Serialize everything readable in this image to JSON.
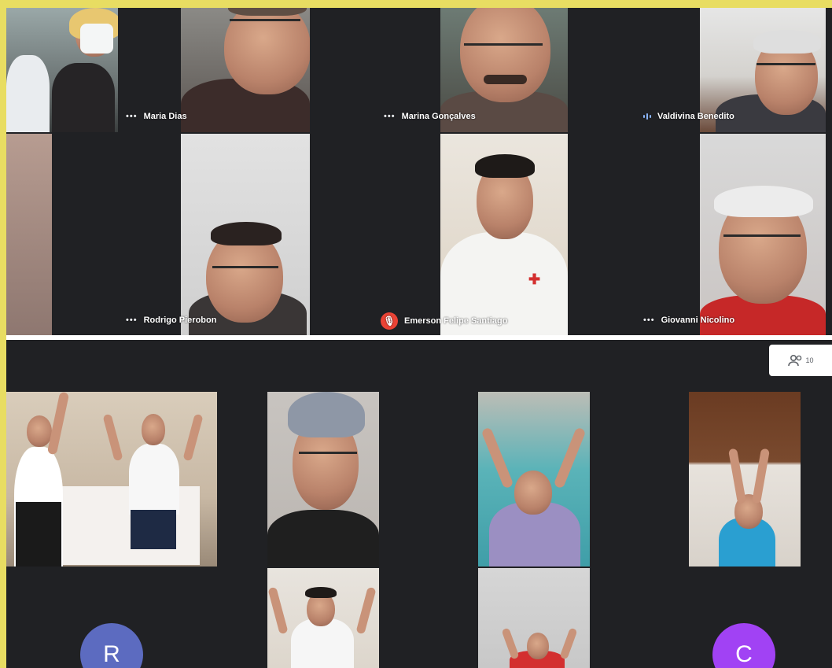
{
  "top_grid": {
    "participants": [
      {
        "name": "Maria Dias",
        "status_icon": "more-options-icon"
      },
      {
        "name": "Marina Gonçalves",
        "status_icon": "more-options-icon"
      },
      {
        "name": "Valdivina Benedito",
        "status_icon": "speaking-indicator-icon"
      },
      {
        "name": "Rodrigo Pierobon",
        "status_icon": "more-options-icon"
      },
      {
        "name": "Emerson Felipe Santiago",
        "status_icon": "mic-off-icon"
      },
      {
        "name": "Giovanni Nicolino",
        "status_icon": "more-options-icon"
      }
    ]
  },
  "bottom_grid": {
    "participant_count": "10",
    "avatars": [
      {
        "letter": "R",
        "color": "#5c6bc0"
      },
      {
        "letter": "C",
        "color": "#a142f4"
      }
    ]
  },
  "colors": {
    "background": "#e8dd62",
    "meeting_bg": "#202124",
    "mic_off": "#ea4335"
  }
}
